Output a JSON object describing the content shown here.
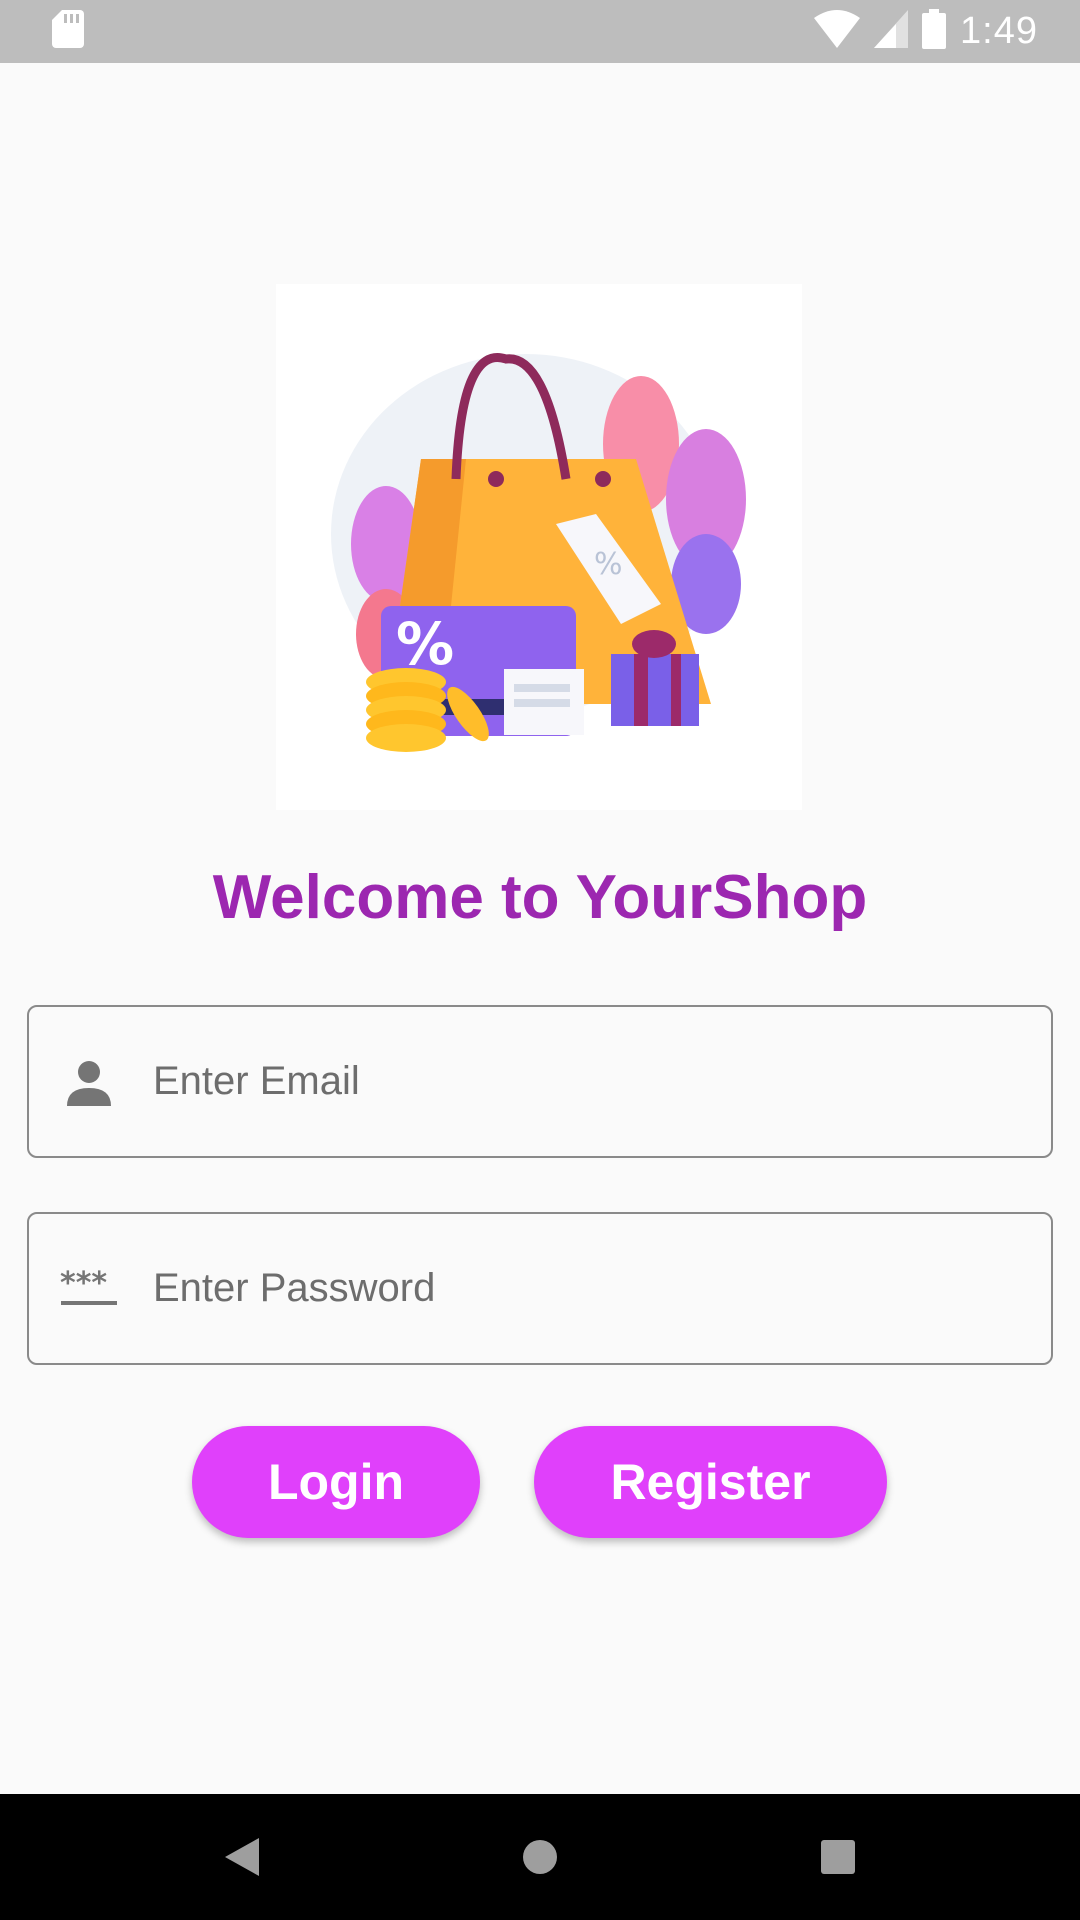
{
  "status_bar": {
    "time": "1:49",
    "icons": [
      "sd-card-icon",
      "wifi-icon",
      "cellular-signal-icon",
      "battery-icon"
    ]
  },
  "main": {
    "illustration": "shopping-bag-illustration",
    "welcome_title": "Welcome to YourShop",
    "email_field": {
      "placeholder": "Enter Email",
      "value": "",
      "icon": "person-icon"
    },
    "password_field": {
      "placeholder": "Enter Password",
      "value": "",
      "icon": "password-icon"
    },
    "login_label": "Login",
    "register_label": "Register"
  },
  "nav_bar": {
    "icons": [
      "back-icon",
      "home-icon",
      "recents-icon"
    ]
  },
  "colors": {
    "accent": "#e040fb",
    "title": "#9c27b0",
    "status_bar": "#bdbdbd",
    "background": "#fafafa"
  }
}
